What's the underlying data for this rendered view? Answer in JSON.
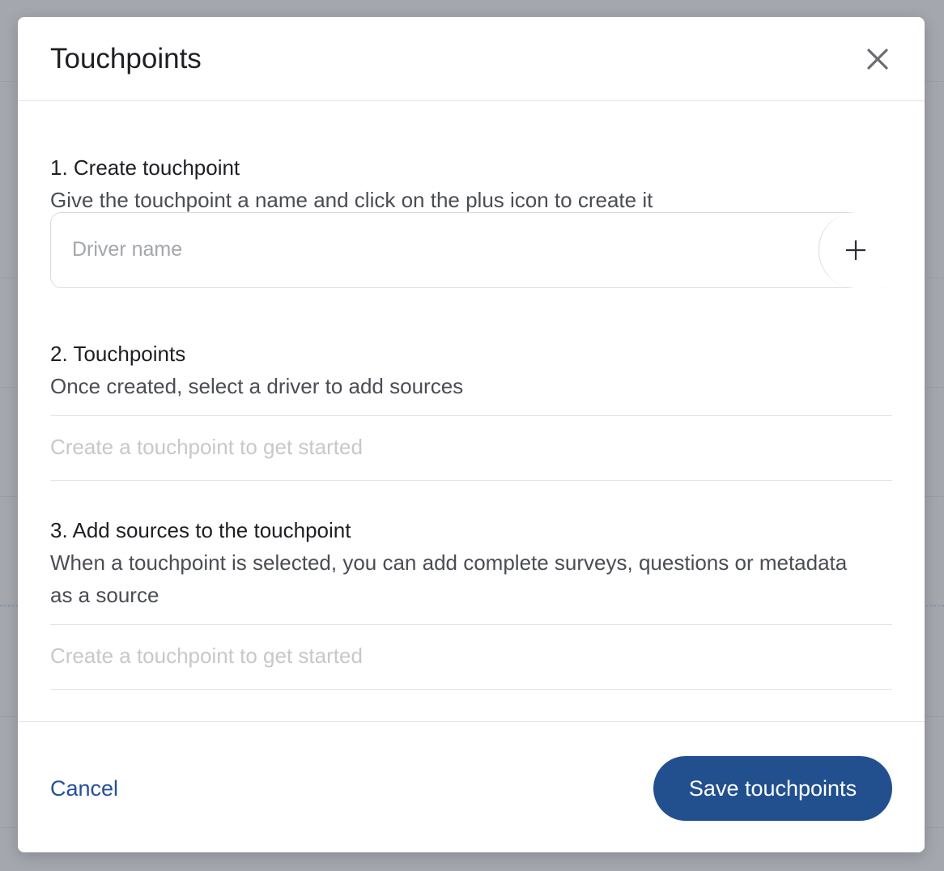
{
  "modal": {
    "title": "Touchpoints",
    "close_icon": "close-icon"
  },
  "step1": {
    "title": "1. Create touchpoint",
    "description": "Give the touchpoint a name and click on the plus icon to create it",
    "input_placeholder": "Driver name",
    "input_value": "",
    "add_icon": "plus-icon"
  },
  "step2": {
    "title": "2. Touchpoints",
    "description": "Once created, select a driver to add sources",
    "empty_text": "Create a touchpoint to get started"
  },
  "step3": {
    "title": "3. Add sources to the touchpoint",
    "description": "When a touchpoint is selected, you can add complete surveys, questions or metadata as a source",
    "empty_text": "Create a touchpoint to get started"
  },
  "footer": {
    "cancel_label": "Cancel",
    "save_label": "Save touchpoints"
  },
  "colors": {
    "primary": "#22508f",
    "link": "#245197",
    "overlay": "#a4a7ae"
  }
}
